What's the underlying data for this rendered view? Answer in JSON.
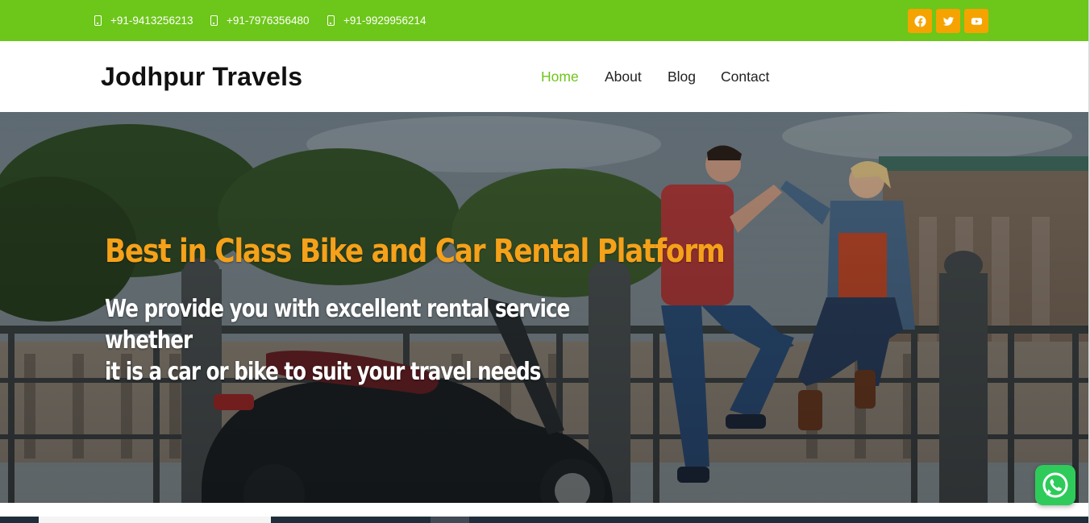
{
  "topbar": {
    "phones": [
      "+91-9413256213",
      "+91-7976356480",
      "+91-9929956214"
    ],
    "social": [
      {
        "icon": "facebook-icon"
      },
      {
        "icon": "twitter-icon"
      },
      {
        "icon": "youtube-icon"
      }
    ]
  },
  "header": {
    "logo": "Jodhpur Travels",
    "nav": [
      {
        "label": "Home",
        "active": true
      },
      {
        "label": "About",
        "active": false
      },
      {
        "label": "Blog",
        "active": false
      },
      {
        "label": "Contact",
        "active": false
      }
    ]
  },
  "hero": {
    "title": "Best in Class Bike and Car Rental Platform",
    "subtitle_line1": "We provide you with excellent rental service whether",
    "subtitle_line2": "it is a car or bike to suit your travel needs"
  },
  "colors": {
    "topbar_bg": "#6dc61a",
    "social_bg": "#f5a300",
    "nav_active": "#6dc61a",
    "hero_title": "#f5a11a",
    "whatsapp": "#2ecb5a"
  }
}
